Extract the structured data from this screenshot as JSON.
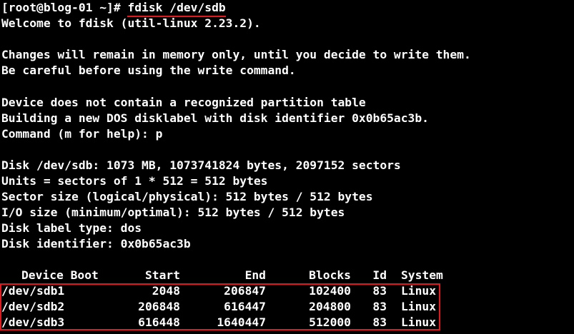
{
  "prompt": "[root@blog-01 ~]# ",
  "command": "fdisk /dev/sdb",
  "output_lines": [
    "Welcome to fdisk (util-linux 2.23.2).",
    "",
    "Changes will remain in memory only, until you decide to write them.",
    "Be careful before using the write command.",
    "",
    "Device does not contain a recognized partition table",
    "Building a new DOS disklabel with disk identifier 0x0b65ac3b.",
    "Command (m for help): p",
    "",
    "Disk /dev/sdb: 1073 MB, 1073741824 bytes, 2097152 sectors",
    "Units = sectors of 1 * 512 = 512 bytes",
    "Sector size (logical/physical): 512 bytes / 512 bytes",
    "I/O size (minimum/optimal): 512 bytes / 512 bytes",
    "Disk label type: dos",
    "Disk identifier: 0x0b65ac3b",
    ""
  ],
  "partition_table": {
    "headers": {
      "device_boot": "Device Boot",
      "start": "Start",
      "end": "End",
      "blocks": "Blocks",
      "id": "Id",
      "system": "System"
    },
    "rows": [
      {
        "device": "/dev/sdb1",
        "start": "2048",
        "end": "206847",
        "blocks": "102400",
        "id": "83",
        "system": "Linux"
      },
      {
        "device": "/dev/sdb2",
        "start": "206848",
        "end": "616447",
        "blocks": "204800",
        "id": "83",
        "system": "Linux"
      },
      {
        "device": "/dev/sdb3",
        "start": "616448",
        "end": "1640447",
        "blocks": "512000",
        "id": "83",
        "system": "Linux"
      }
    ]
  },
  "colors": {
    "background": "#000000",
    "text": "#ffffff",
    "annotation": "#e0191f"
  }
}
